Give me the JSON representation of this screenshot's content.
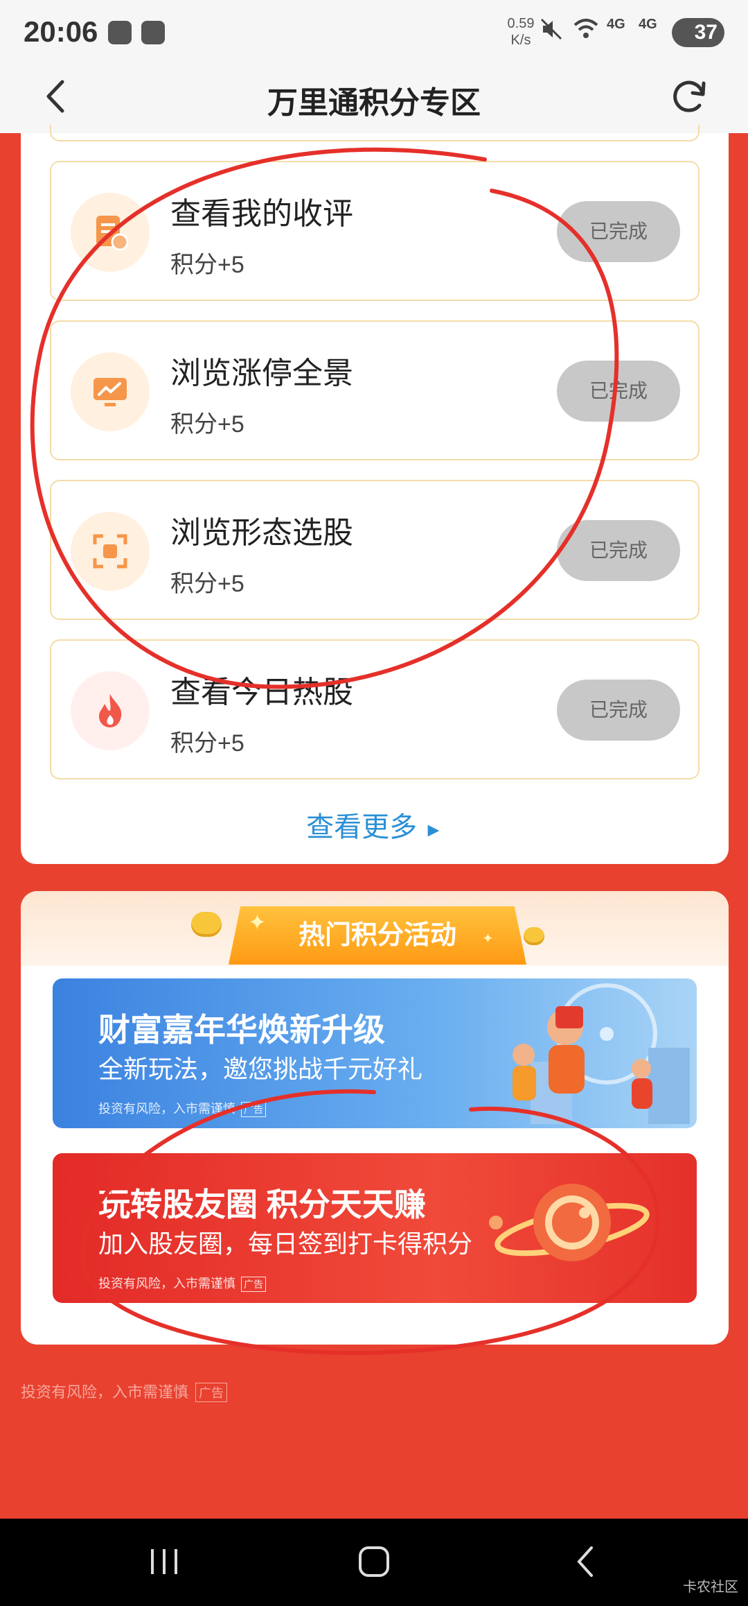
{
  "status_bar": {
    "time": "20:06",
    "net_speed_value": "0.59",
    "net_speed_unit": "K/s",
    "signal_1": "4G",
    "signal_2": "4G",
    "battery": "37"
  },
  "header": {
    "title": "万里通积分专区"
  },
  "tasks": [
    {
      "name": "查看我的收评",
      "points": "积分+5",
      "button": "已完成",
      "icon": "document-icon",
      "icon_color": "#f5964a"
    },
    {
      "name": "浏览涨停全景",
      "points": "积分+5",
      "button": "已完成",
      "icon": "chart-monitor-icon",
      "icon_color": "#f5964a"
    },
    {
      "name": "浏览形态选股",
      "points": "积分+5",
      "button": "已完成",
      "icon": "scan-frame-icon",
      "icon_color": "#f5964a"
    },
    {
      "name": "查看今日热股",
      "points": "积分+5",
      "button": "已完成",
      "icon": "flame-icon",
      "icon_color": "#f0584a"
    }
  ],
  "more_link": {
    "label": "查看更多",
    "arrow": "►"
  },
  "activities": {
    "heading": "热门积分活动",
    "banners": [
      {
        "title": "财富嘉年华焕新升级",
        "subtitle": "全新玩法，邀您挑战千元好礼",
        "risk_note": "投资有风险，入市需谨慎",
        "ad_tag": "广告"
      },
      {
        "title": "玩转股友圈 积分天天赚",
        "subtitle": "加入股友圈，每日签到打卡得积分",
        "risk_note": "投资有风险，入市需谨慎",
        "ad_tag": "广告"
      }
    ]
  },
  "footer": {
    "risk_note": "投资有风险，入市需谨慎",
    "ad_tag": "广告"
  },
  "watermark": "卡农社区",
  "colors": {
    "page_bg": "#e8412f",
    "link_blue": "#2b8fd6",
    "done_button": "#c8c8c8",
    "card_border": "#f4dca8",
    "annotation_red": "#e5302a"
  }
}
